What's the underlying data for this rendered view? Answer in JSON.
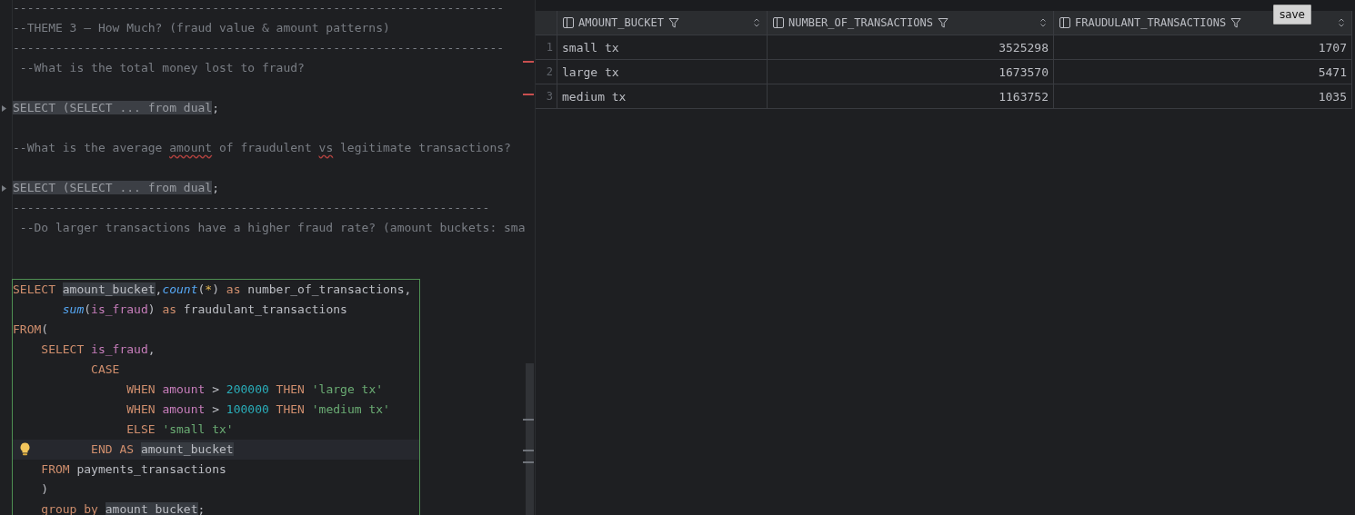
{
  "editor": {
    "blocks": [
      {
        "outlined": false,
        "lines": [
          {
            "kind": "code",
            "tokens": [
              {
                "kind": "comment",
                "text": "---------------------------------------------------------------------"
              }
            ]
          },
          {
            "kind": "code",
            "tokens": [
              {
                "kind": "comment",
                "text": "--THEME 3 — How Much? (fraud value & amount patterns)"
              }
            ]
          },
          {
            "kind": "code",
            "tokens": [
              {
                "kind": "comment",
                "text": "---------------------------------------------------------------------"
              }
            ]
          },
          {
            "kind": "code",
            "tokens": [
              {
                "kind": "comment",
                "text": " --What is the total money lost to fraud?"
              }
            ]
          },
          {
            "kind": "blank"
          },
          {
            "kind": "code",
            "folded": true,
            "tokens": [
              {
                "kind": "folded",
                "text": "SELECT (SELECT ... from dual"
              },
              {
                "kind": "plain",
                "text": ";"
              }
            ]
          },
          {
            "kind": "blank"
          },
          {
            "kind": "code",
            "tokens": [
              {
                "kind": "comment",
                "text": "--What is the average "
              },
              {
                "kind": "comment",
                "text": "amount",
                "misspelled": true
              },
              {
                "kind": "comment",
                "text": " of fraudulent "
              },
              {
                "kind": "comment",
                "text": "vs",
                "misspelled": true
              },
              {
                "kind": "comment",
                "text": " legitimate transactions?"
              }
            ]
          },
          {
            "kind": "blank"
          },
          {
            "kind": "code",
            "folded": true,
            "tokens": [
              {
                "kind": "folded",
                "text": "SELECT (SELECT ... from dual"
              },
              {
                "kind": "plain",
                "text": ";"
              }
            ]
          },
          {
            "kind": "code",
            "tokens": [
              {
                "kind": "comment",
                "text": "-------------------------------------------------------------------"
              }
            ]
          },
          {
            "kind": "code",
            "tokens": [
              {
                "kind": "comment",
                "text": " --Do larger transactions have a higher fraud rate? (amount buckets: sma"
              }
            ]
          },
          {
            "kind": "blank"
          },
          {
            "kind": "blank"
          }
        ]
      },
      {
        "outlined": true,
        "lines": [
          {
            "kind": "code",
            "tokens": [
              {
                "kind": "keyword",
                "text": "SELECT "
              },
              {
                "kind": "plain",
                "text": "amount_bucket",
                "highlighted": true
              },
              {
                "kind": "plain",
                "text": ","
              },
              {
                "kind": "function",
                "text": "count"
              },
              {
                "kind": "plain",
                "text": "("
              },
              {
                "kind": "star",
                "text": "*"
              },
              {
                "kind": "plain",
                "text": ") "
              },
              {
                "kind": "keyword",
                "text": "as"
              },
              {
                "kind": "plain",
                "text": " number_of_transactions,"
              }
            ]
          },
          {
            "kind": "code",
            "tokens": [
              {
                "kind": "function",
                "text": "       sum"
              },
              {
                "kind": "plain",
                "text": "("
              },
              {
                "kind": "column",
                "text": "is_fraud"
              },
              {
                "kind": "plain",
                "text": ") "
              },
              {
                "kind": "keyword",
                "text": "as"
              },
              {
                "kind": "plain",
                "text": " fraudulant_transactions"
              }
            ]
          },
          {
            "kind": "code",
            "tokens": [
              {
                "kind": "keyword",
                "text": "FROM"
              },
              {
                "kind": "plain",
                "text": "("
              }
            ]
          },
          {
            "kind": "code",
            "tokens": [
              {
                "kind": "keyword",
                "text": "    SELECT "
              },
              {
                "kind": "column",
                "text": "is_fraud"
              },
              {
                "kind": "plain",
                "text": ","
              }
            ]
          },
          {
            "kind": "code",
            "tokens": [
              {
                "kind": "keyword",
                "text": "           CASE"
              }
            ]
          },
          {
            "kind": "code",
            "tokens": [
              {
                "kind": "keyword",
                "text": "                WHEN "
              },
              {
                "kind": "column",
                "text": "amount"
              },
              {
                "kind": "plain",
                "text": " > "
              },
              {
                "kind": "number",
                "text": "200000"
              },
              {
                "kind": "keyword",
                "text": " THEN "
              },
              {
                "kind": "string",
                "text": "'large tx'"
              }
            ]
          },
          {
            "kind": "code",
            "tokens": [
              {
                "kind": "keyword",
                "text": "                WHEN "
              },
              {
                "kind": "column",
                "text": "amount"
              },
              {
                "kind": "plain",
                "text": " > "
              },
              {
                "kind": "number",
                "text": "100000"
              },
              {
                "kind": "keyword",
                "text": " THEN "
              },
              {
                "kind": "string",
                "text": "'medium tx'"
              }
            ]
          },
          {
            "kind": "code",
            "tokens": [
              {
                "kind": "keyword",
                "text": "                ELSE "
              },
              {
                "kind": "string",
                "text": "'small tx'"
              }
            ]
          },
          {
            "kind": "code",
            "current": true,
            "tokens": [
              {
                "kind": "keyword",
                "text": "           END AS "
              },
              {
                "kind": "plain",
                "text": "amount_bucket",
                "highlighted": true
              }
            ]
          },
          {
            "kind": "code",
            "tokens": [
              {
                "kind": "keyword",
                "text": "    FROM"
              },
              {
                "kind": "plain",
                "text": " payments_transactions"
              }
            ]
          },
          {
            "kind": "code",
            "tokens": [
              {
                "kind": "plain",
                "text": "    )"
              }
            ]
          },
          {
            "kind": "code",
            "tokens": [
              {
                "kind": "keyword",
                "text": "    group by "
              },
              {
                "kind": "plain",
                "text": "amount_bucket",
                "highlighted": true
              },
              {
                "kind": "plain",
                "text": ";"
              }
            ]
          }
        ]
      }
    ]
  },
  "results": {
    "save_button": "save",
    "columns": [
      {
        "label": "AMOUNT_BUCKET"
      },
      {
        "label": "NUMBER_OF_TRANSACTIONS"
      },
      {
        "label": "FRAUDULANT_TRANSACTIONS"
      }
    ],
    "rows": [
      {
        "number": "1",
        "cells": [
          "small tx",
          "3525298",
          "1707"
        ]
      },
      {
        "number": "2",
        "cells": [
          "large tx",
          "1673570",
          "5471"
        ]
      },
      {
        "number": "3",
        "cells": [
          "medium tx",
          "1163752",
          "1035"
        ]
      }
    ]
  }
}
